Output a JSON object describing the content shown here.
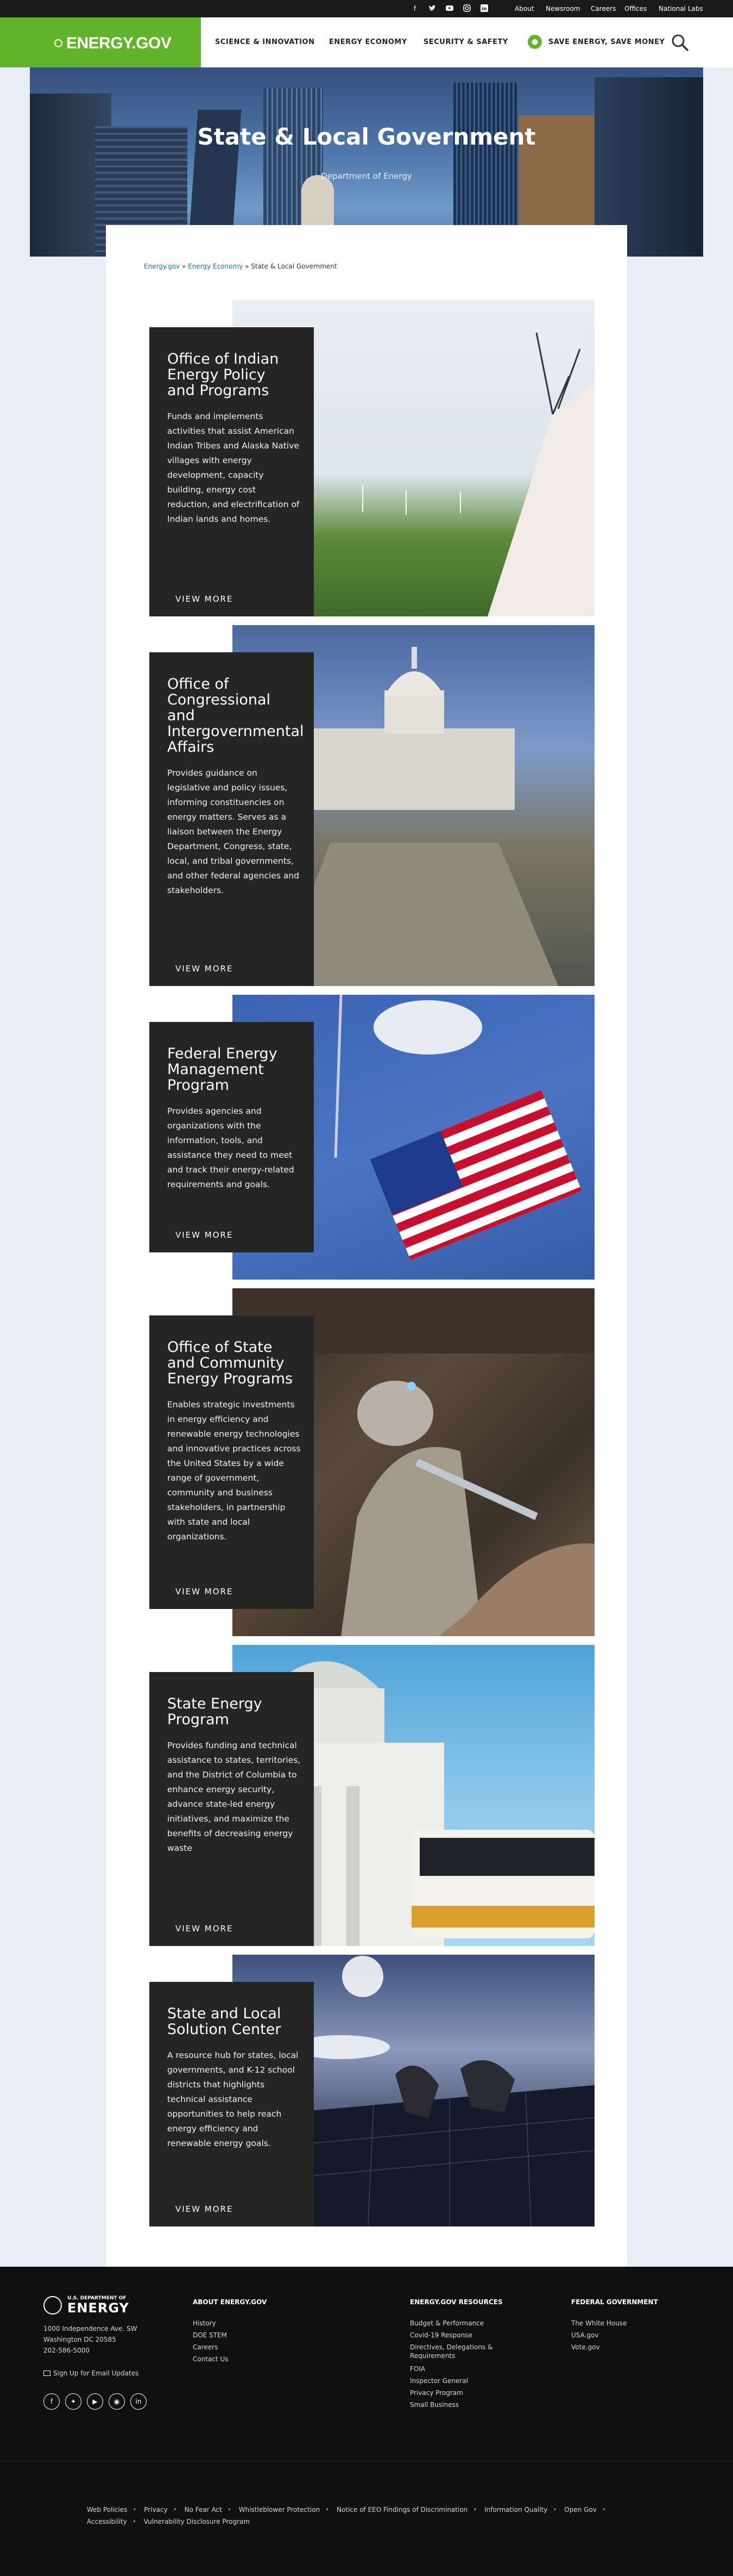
{
  "topbar": {
    "social": [
      "facebook-icon",
      "twitter-icon",
      "youtube-icon",
      "instagram-icon",
      "linkedin-icon"
    ],
    "links": [
      "About",
      "Newsroom",
      "Careers",
      "Offices",
      "National Labs"
    ]
  },
  "header": {
    "logo": "ENERGY.GOV",
    "nav": [
      "SCIENCE & INNOVATION",
      "ENERGY ECONOMY",
      "SECURITY & SAFETY"
    ],
    "save": "SAVE ENERGY, SAVE MONEY"
  },
  "hero": {
    "title": "State & Local Government",
    "subtitle": "Department of Energy"
  },
  "breadcrumb": {
    "home": "Energy.gov",
    "sep1": " » ",
    "section": "Energy Economy",
    "sep2": " » ",
    "current": "State & Local Government"
  },
  "cards": [
    {
      "title": "Office of Indian Energy Policy and Programs",
      "desc": "Funds and implements activities that assist American Indian Tribes and Alaska Native villages with energy development, capacity building, energy cost reduction, and electrification of Indian lands and homes.",
      "cta": "VIEW MORE"
    },
    {
      "title": "Office of Congressional and Intergovernmental Affairs",
      "desc": "Provides guidance on legislative and policy issues, informing constituencies on energy matters. Serves as a liaison between the Energy Department, Congress, state, local, and tribal governments, and other federal agencies and stakeholders.",
      "cta": "VIEW MORE"
    },
    {
      "title": "Federal Energy Management Program",
      "desc": "Provides agencies and organizations with the information, tools, and assistance they need to meet and track their energy-related requirements and goals.",
      "cta": "VIEW MORE"
    },
    {
      "title": "Office of State and Community Energy Programs",
      "desc": "Enables strategic investments in energy efficiency and renewable energy technologies and innovative practices across the United States by a wide range of government, community and business stakeholders, in partnership with state and local organizations.",
      "cta": "VIEW MORE"
    },
    {
      "title": "State Energy Program",
      "desc": "Provides funding and technical assistance to states, territories, and the District of Columbia to enhance energy security, advance state-led energy initiatives, and maximize the benefits of decreasing energy waste",
      "cta": "VIEW MORE"
    },
    {
      "title": "State and Local Solution Center",
      "desc": "A resource hub for states, local governments, and K-12 school districts that highlights technical assistance opportunities to help reach energy efficiency and renewable energy goals.",
      "cta": "VIEW MORE"
    }
  ],
  "footer": {
    "logo_small": "U.S. DEPARTMENT OF",
    "logo": "ENERGY",
    "address": [
      "1000 Independence Ave. SW",
      "Washington DC 20585",
      "202-586-5000"
    ],
    "signup": "Sign Up for Email Updates",
    "col1": {
      "title": "ABOUT ENERGY.GOV",
      "links": [
        "History",
        "DOE STEM",
        "Careers",
        "Contact Us"
      ]
    },
    "col2": {
      "title": "ENERGY.GOV RESOURCES",
      "links": [
        "Budget & Performance",
        "Covid-19 Response",
        "Directives, Delegations & Requirements",
        "FOIA",
        "Inspector General",
        "Privacy Program",
        "Small Business"
      ]
    },
    "col3": {
      "title": "FEDERAL GOVERNMENT",
      "links": [
        "The White House",
        "USA.gov",
        "Vote.gov"
      ]
    },
    "legal": [
      "Web Policies",
      "Privacy",
      "No Fear Act",
      "Whistleblower Protection",
      "Notice of EEO Findings of Discrimination",
      "Information Quality",
      "Open Gov",
      "Accessibility",
      "Vulnerability Disclosure Program"
    ]
  }
}
